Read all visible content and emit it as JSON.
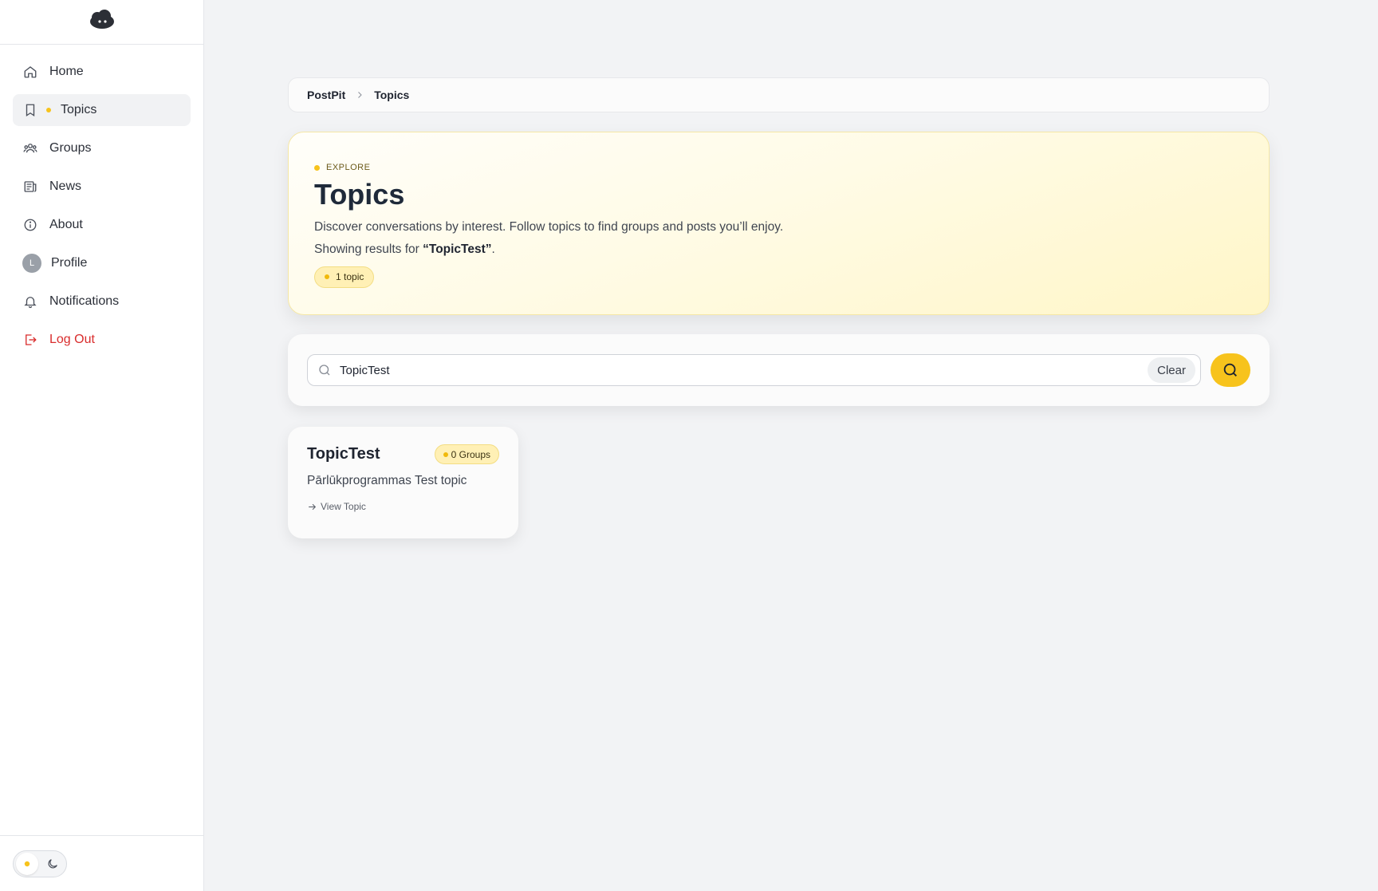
{
  "sidebar": {
    "logo": "cloud-logo",
    "items": [
      {
        "label": "Home",
        "icon": "home-icon"
      },
      {
        "label": "Topics",
        "icon": "bookmark-icon",
        "active": true
      },
      {
        "label": "Groups",
        "icon": "users-icon"
      },
      {
        "label": "News",
        "icon": "newspaper-icon"
      },
      {
        "label": "About",
        "icon": "info-icon"
      },
      {
        "label": "Profile",
        "icon": "avatar",
        "avatar_initial": "L"
      },
      {
        "label": "Notifications",
        "icon": "bell-icon"
      },
      {
        "label": "Log Out",
        "icon": "logout-icon"
      }
    ],
    "theme_toggle": {
      "options": [
        "sun-icon",
        "moon-icon"
      ],
      "selected": "light"
    }
  },
  "breadcrumb": {
    "root": "PostPit",
    "current": "Topics"
  },
  "hero": {
    "eyebrow": "EXPLORE",
    "title": "Topics",
    "description": "Discover conversations by interest. Follow topics to find groups and posts you’ll enjoy.",
    "results_prefix": "Showing results for ",
    "results_query": "“TopicTest”",
    "results_suffix": ".",
    "count_label": "1 topic"
  },
  "search": {
    "value": "TopicTest",
    "clear_label": "Clear"
  },
  "topics": [
    {
      "name": "TopicTest",
      "groups_label": "0 Groups",
      "description": "Pārlūkprogrammas Test topic",
      "link_label": "View Topic"
    }
  ],
  "colors": {
    "accent": "#f7c31c",
    "logout": "#d92d2d",
    "background": "#f2f3f5"
  }
}
